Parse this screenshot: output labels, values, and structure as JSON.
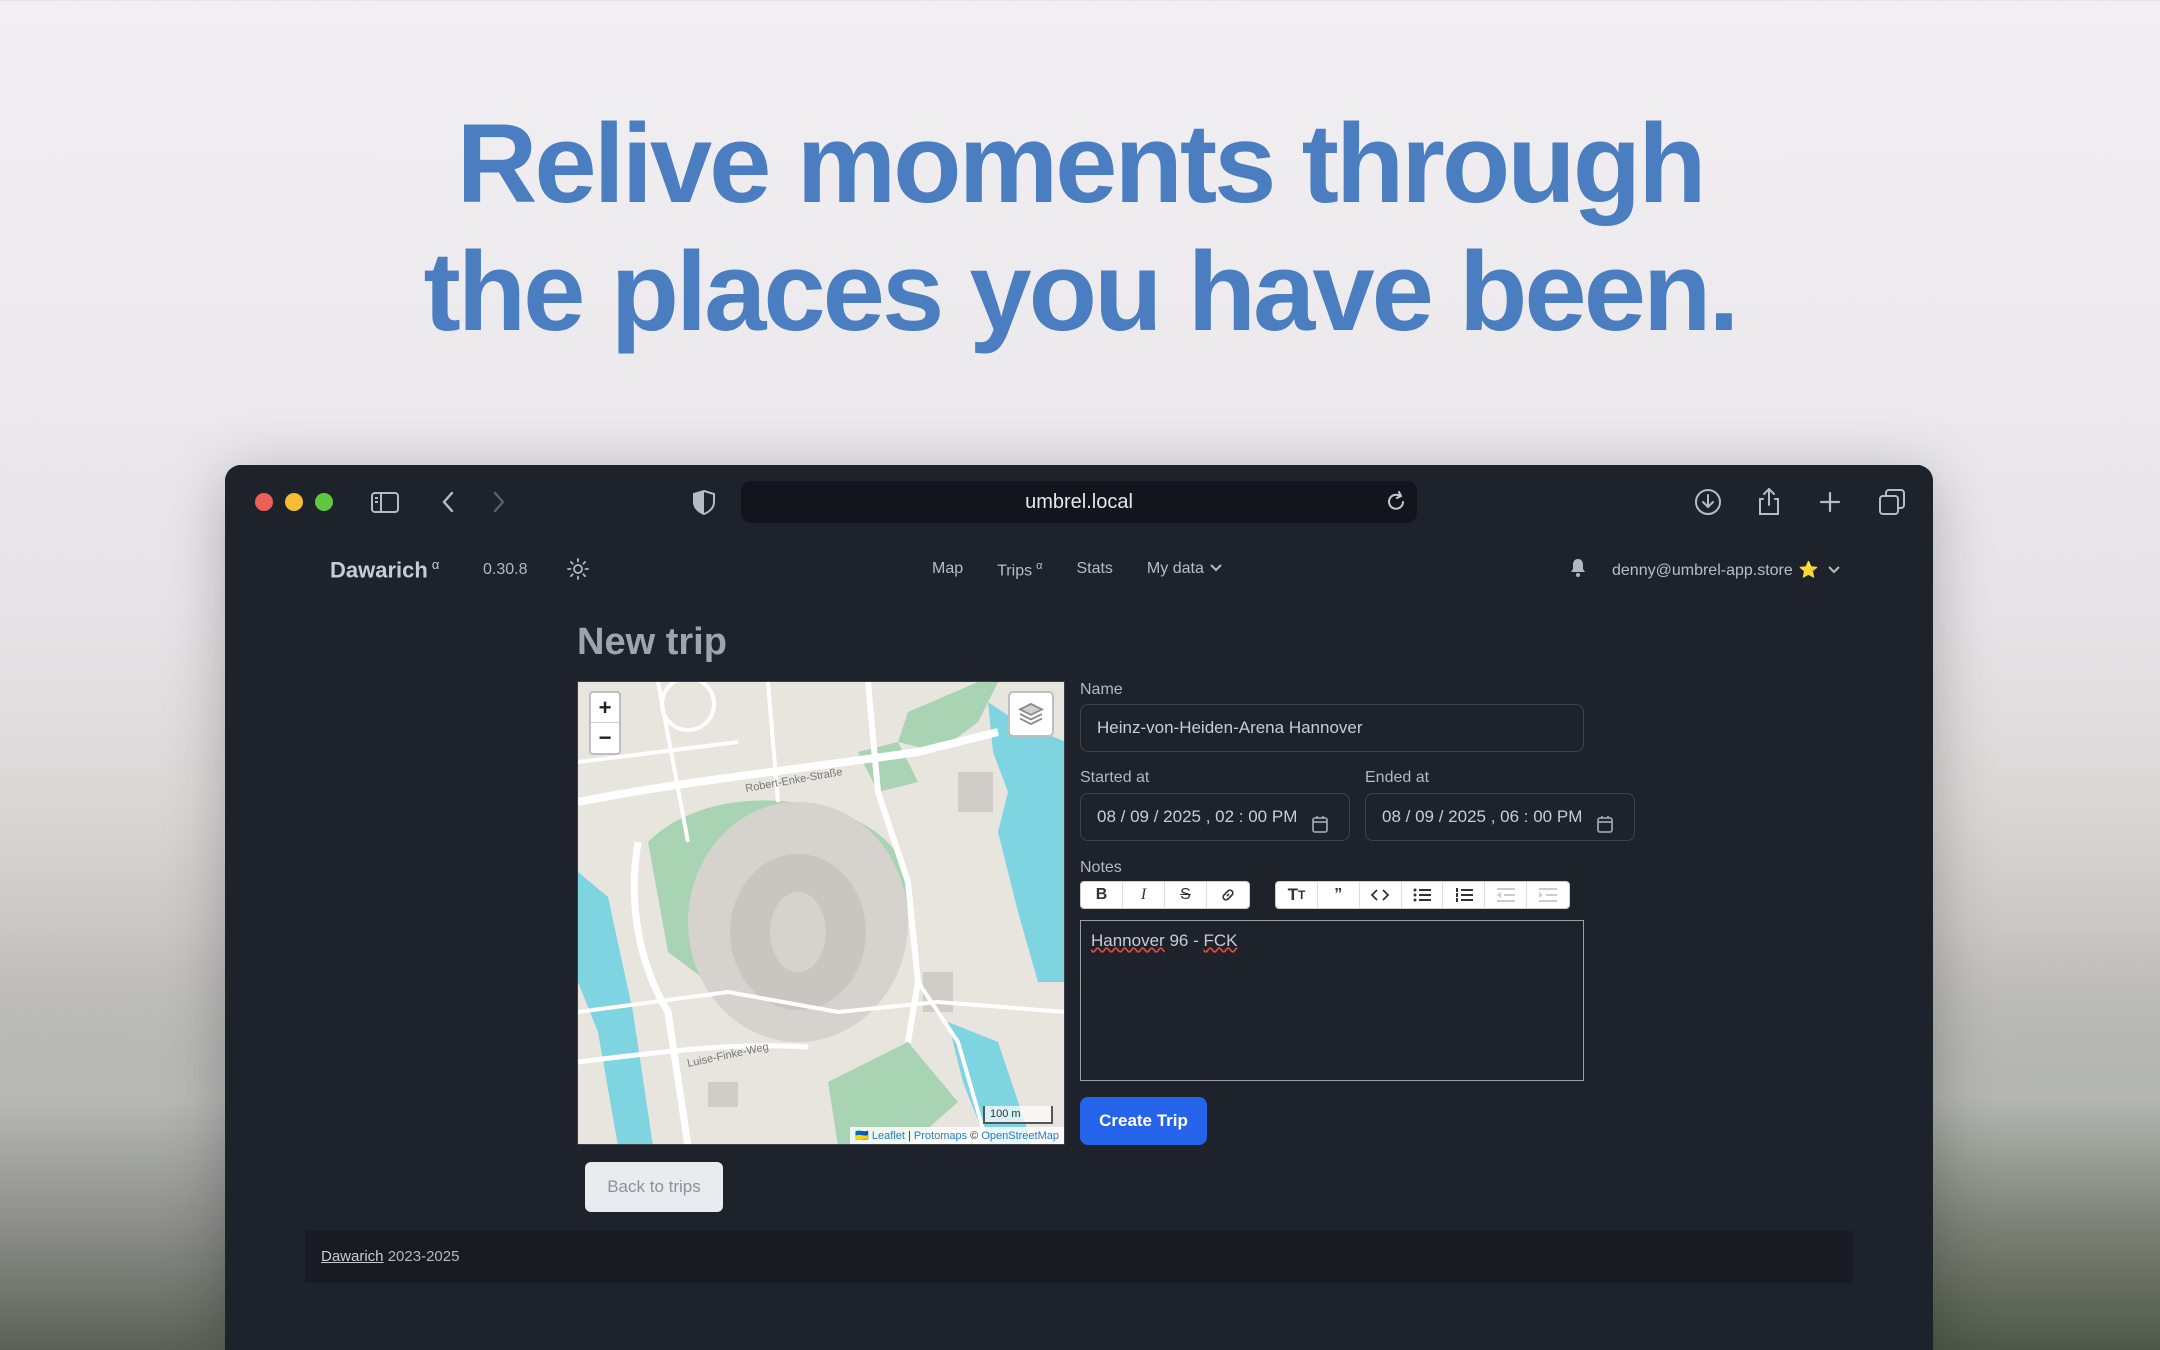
{
  "hero": {
    "line1": "Relive moments through",
    "line2": "the places you have been."
  },
  "browser": {
    "url": "umbrel.local",
    "icons": [
      "sidebar-icon",
      "back-icon",
      "forward-icon",
      "shield-icon",
      "reload-icon",
      "download-icon",
      "share-icon",
      "new-tab-icon",
      "tabs-overview-icon"
    ]
  },
  "nav": {
    "brand": "Dawarich",
    "brand_sup": "α",
    "version": "0.30.8",
    "links": [
      {
        "label": "Map"
      },
      {
        "label": "Trips",
        "sup": "α"
      },
      {
        "label": "Stats"
      },
      {
        "label": "My data"
      }
    ],
    "user_email": "denny@umbrel-app.store",
    "user_badge": "⭐"
  },
  "page": {
    "title": "New trip"
  },
  "map": {
    "zoom_in": "+",
    "zoom_out": "−",
    "scale_label": "100 m",
    "attribution": {
      "flag": "🇺🇦",
      "leaflet": "Leaflet",
      "separator": " | ",
      "protomaps": "Protomaps",
      "osm_prefix": " © ",
      "osm": "OpenStreetMap"
    },
    "streets": [
      "Robert-Enke-Straße",
      "Luise-Finke-Weg"
    ]
  },
  "form": {
    "name_label": "Name",
    "name_value": "Heinz-von-Heiden-Arena Hannover",
    "started_label": "Started at",
    "started_value": "08 / 09 / 2025 ,  02 : 00   PM",
    "ended_label": "Ended at",
    "ended_value": "08 / 09 / 2025 ,  06 : 00   PM",
    "notes_label": "Notes",
    "notes_text_a": "Hannover",
    "notes_text_b": " 96 - ",
    "notes_text_c": "FCK",
    "create_button": "Create Trip",
    "back_button": "Back to trips"
  },
  "footer": {
    "link": "Dawarich",
    "years": " 2023-2025"
  },
  "colors": {
    "hero_text": "#4a7ec0",
    "app_bg": "#1e232b",
    "primary_button": "#2563eb"
  }
}
